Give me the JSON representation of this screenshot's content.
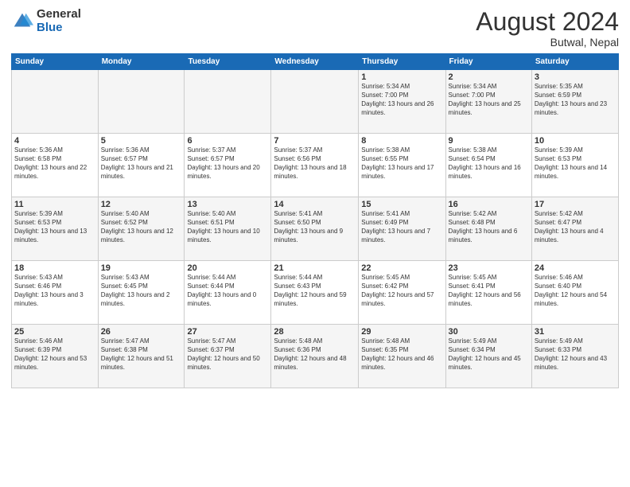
{
  "header": {
    "logo_general": "General",
    "logo_blue": "Blue",
    "title": "August 2024",
    "subtitle": "Butwal, Nepal"
  },
  "days_of_week": [
    "Sunday",
    "Monday",
    "Tuesday",
    "Wednesday",
    "Thursday",
    "Friday",
    "Saturday"
  ],
  "weeks": [
    [
      {
        "day": "",
        "sunrise": "",
        "sunset": "",
        "daylight": ""
      },
      {
        "day": "",
        "sunrise": "",
        "sunset": "",
        "daylight": ""
      },
      {
        "day": "",
        "sunrise": "",
        "sunset": "",
        "daylight": ""
      },
      {
        "day": "",
        "sunrise": "",
        "sunset": "",
        "daylight": ""
      },
      {
        "day": "1",
        "sunrise": "Sunrise: 5:34 AM",
        "sunset": "Sunset: 7:00 PM",
        "daylight": "Daylight: 13 hours and 26 minutes."
      },
      {
        "day": "2",
        "sunrise": "Sunrise: 5:34 AM",
        "sunset": "Sunset: 7:00 PM",
        "daylight": "Daylight: 13 hours and 25 minutes."
      },
      {
        "day": "3",
        "sunrise": "Sunrise: 5:35 AM",
        "sunset": "Sunset: 6:59 PM",
        "daylight": "Daylight: 13 hours and 23 minutes."
      }
    ],
    [
      {
        "day": "4",
        "sunrise": "Sunrise: 5:36 AM",
        "sunset": "Sunset: 6:58 PM",
        "daylight": "Daylight: 13 hours and 22 minutes."
      },
      {
        "day": "5",
        "sunrise": "Sunrise: 5:36 AM",
        "sunset": "Sunset: 6:57 PM",
        "daylight": "Daylight: 13 hours and 21 minutes."
      },
      {
        "day": "6",
        "sunrise": "Sunrise: 5:37 AM",
        "sunset": "Sunset: 6:57 PM",
        "daylight": "Daylight: 13 hours and 20 minutes."
      },
      {
        "day": "7",
        "sunrise": "Sunrise: 5:37 AM",
        "sunset": "Sunset: 6:56 PM",
        "daylight": "Daylight: 13 hours and 18 minutes."
      },
      {
        "day": "8",
        "sunrise": "Sunrise: 5:38 AM",
        "sunset": "Sunset: 6:55 PM",
        "daylight": "Daylight: 13 hours and 17 minutes."
      },
      {
        "day": "9",
        "sunrise": "Sunrise: 5:38 AM",
        "sunset": "Sunset: 6:54 PM",
        "daylight": "Daylight: 13 hours and 16 minutes."
      },
      {
        "day": "10",
        "sunrise": "Sunrise: 5:39 AM",
        "sunset": "Sunset: 6:53 PM",
        "daylight": "Daylight: 13 hours and 14 minutes."
      }
    ],
    [
      {
        "day": "11",
        "sunrise": "Sunrise: 5:39 AM",
        "sunset": "Sunset: 6:53 PM",
        "daylight": "Daylight: 13 hours and 13 minutes."
      },
      {
        "day": "12",
        "sunrise": "Sunrise: 5:40 AM",
        "sunset": "Sunset: 6:52 PM",
        "daylight": "Daylight: 13 hours and 12 minutes."
      },
      {
        "day": "13",
        "sunrise": "Sunrise: 5:40 AM",
        "sunset": "Sunset: 6:51 PM",
        "daylight": "Daylight: 13 hours and 10 minutes."
      },
      {
        "day": "14",
        "sunrise": "Sunrise: 5:41 AM",
        "sunset": "Sunset: 6:50 PM",
        "daylight": "Daylight: 13 hours and 9 minutes."
      },
      {
        "day": "15",
        "sunrise": "Sunrise: 5:41 AM",
        "sunset": "Sunset: 6:49 PM",
        "daylight": "Daylight: 13 hours and 7 minutes."
      },
      {
        "day": "16",
        "sunrise": "Sunrise: 5:42 AM",
        "sunset": "Sunset: 6:48 PM",
        "daylight": "Daylight: 13 hours and 6 minutes."
      },
      {
        "day": "17",
        "sunrise": "Sunrise: 5:42 AM",
        "sunset": "Sunset: 6:47 PM",
        "daylight": "Daylight: 13 hours and 4 minutes."
      }
    ],
    [
      {
        "day": "18",
        "sunrise": "Sunrise: 5:43 AM",
        "sunset": "Sunset: 6:46 PM",
        "daylight": "Daylight: 13 hours and 3 minutes."
      },
      {
        "day": "19",
        "sunrise": "Sunrise: 5:43 AM",
        "sunset": "Sunset: 6:45 PM",
        "daylight": "Daylight: 13 hours and 2 minutes."
      },
      {
        "day": "20",
        "sunrise": "Sunrise: 5:44 AM",
        "sunset": "Sunset: 6:44 PM",
        "daylight": "Daylight: 13 hours and 0 minutes."
      },
      {
        "day": "21",
        "sunrise": "Sunrise: 5:44 AM",
        "sunset": "Sunset: 6:43 PM",
        "daylight": "Daylight: 12 hours and 59 minutes."
      },
      {
        "day": "22",
        "sunrise": "Sunrise: 5:45 AM",
        "sunset": "Sunset: 6:42 PM",
        "daylight": "Daylight: 12 hours and 57 minutes."
      },
      {
        "day": "23",
        "sunrise": "Sunrise: 5:45 AM",
        "sunset": "Sunset: 6:41 PM",
        "daylight": "Daylight: 12 hours and 56 minutes."
      },
      {
        "day": "24",
        "sunrise": "Sunrise: 5:46 AM",
        "sunset": "Sunset: 6:40 PM",
        "daylight": "Daylight: 12 hours and 54 minutes."
      }
    ],
    [
      {
        "day": "25",
        "sunrise": "Sunrise: 5:46 AM",
        "sunset": "Sunset: 6:39 PM",
        "daylight": "Daylight: 12 hours and 53 minutes."
      },
      {
        "day": "26",
        "sunrise": "Sunrise: 5:47 AM",
        "sunset": "Sunset: 6:38 PM",
        "daylight": "Daylight: 12 hours and 51 minutes."
      },
      {
        "day": "27",
        "sunrise": "Sunrise: 5:47 AM",
        "sunset": "Sunset: 6:37 PM",
        "daylight": "Daylight: 12 hours and 50 minutes."
      },
      {
        "day": "28",
        "sunrise": "Sunrise: 5:48 AM",
        "sunset": "Sunset: 6:36 PM",
        "daylight": "Daylight: 12 hours and 48 minutes."
      },
      {
        "day": "29",
        "sunrise": "Sunrise: 5:48 AM",
        "sunset": "Sunset: 6:35 PM",
        "daylight": "Daylight: 12 hours and 46 minutes."
      },
      {
        "day": "30",
        "sunrise": "Sunrise: 5:49 AM",
        "sunset": "Sunset: 6:34 PM",
        "daylight": "Daylight: 12 hours and 45 minutes."
      },
      {
        "day": "31",
        "sunrise": "Sunrise: 5:49 AM",
        "sunset": "Sunset: 6:33 PM",
        "daylight": "Daylight: 12 hours and 43 minutes."
      }
    ]
  ]
}
